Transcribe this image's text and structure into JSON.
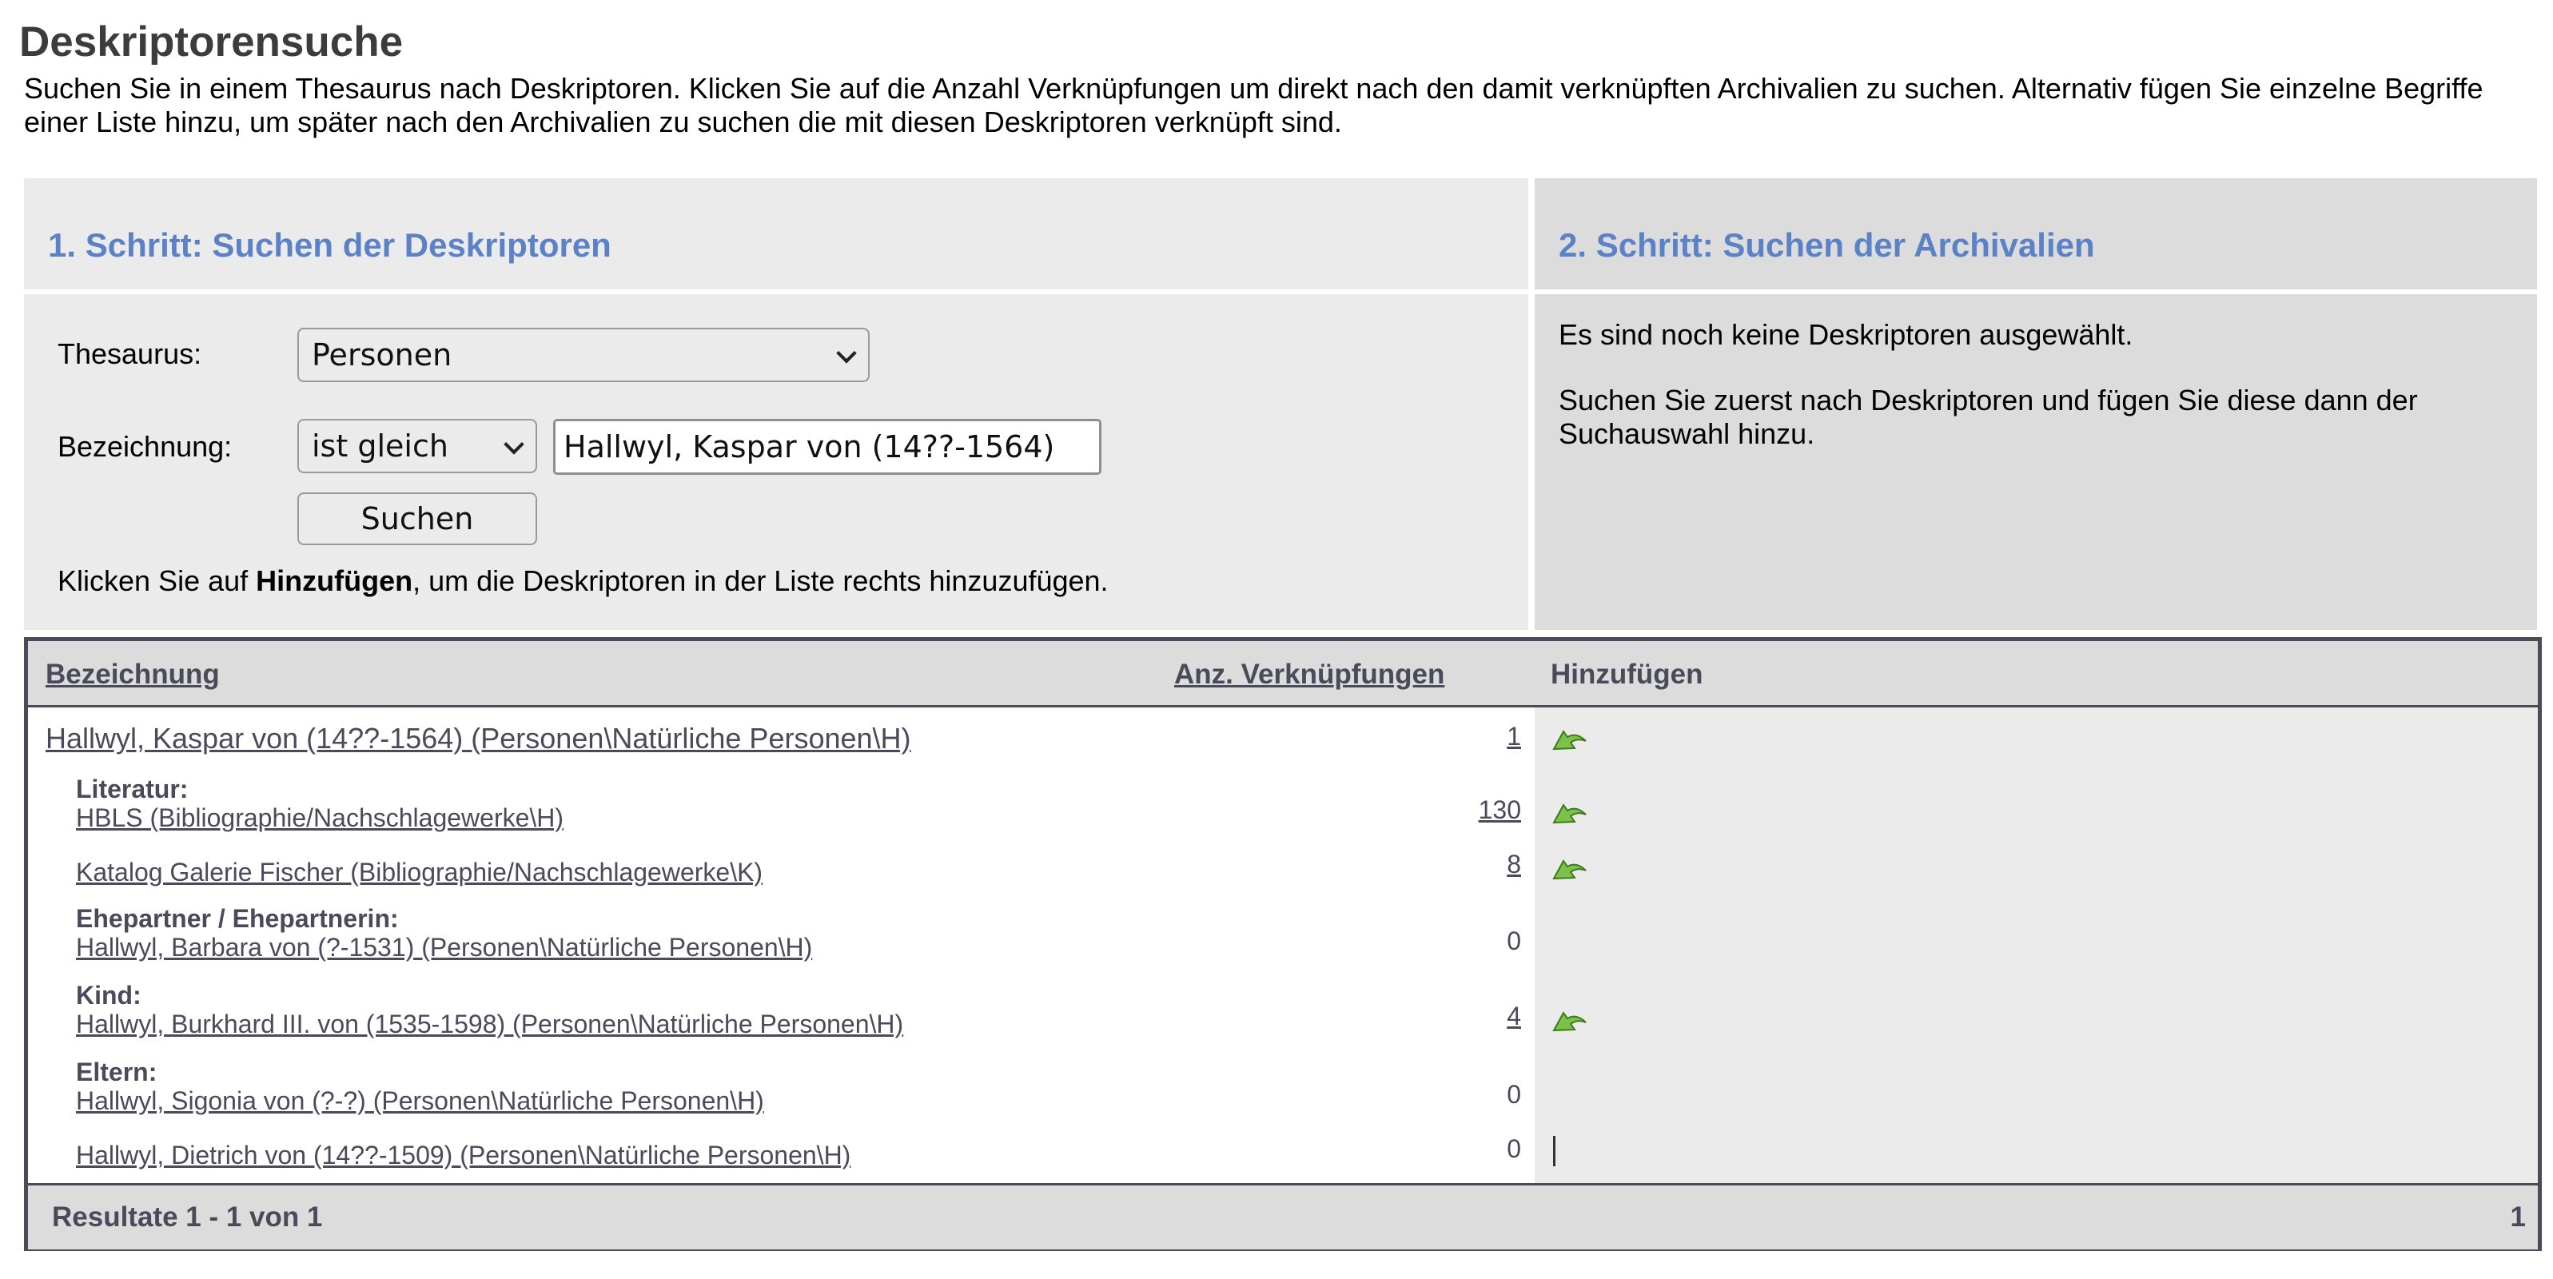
{
  "page": {
    "title": "Deskriptorensuche",
    "intro": "Suchen Sie in einem Thesaurus nach Deskriptoren. Klicken Sie auf die Anzahl Verknüpfungen um direkt nach den damit verknüpften Archivalien zu suchen. Alternativ fügen Sie einzelne Begriffe einer Liste hinzu, um später nach den Archivalien zu suchen die mit diesen Deskriptoren verknüpft sind."
  },
  "step1": {
    "title": "1. Schritt: Suchen der Deskriptoren",
    "thesaurus_label": "Thesaurus:",
    "thesaurus_value": "Personen",
    "bezeichnung_label": "Bezeichnung:",
    "operator_value": "ist gleich",
    "search_value": "Hallwyl, Kaspar von (14??-1564)",
    "search_button": "Suchen",
    "hint_prefix": "Klicken Sie auf ",
    "hint_bold": "Hinzufügen",
    "hint_suffix": ", um die Deskriptoren in der Liste rechts hinzuzufügen."
  },
  "step2": {
    "title": "2. Schritt: Suchen der Archivalien",
    "msg1": "Es sind noch keine Deskriptoren ausgewählt.",
    "msg2": "Suchen Sie zuerst nach Deskriptoren und fügen Sie diese dann der Suchauswahl hinzu."
  },
  "table": {
    "col_name": "Bezeichnung",
    "col_count": "Anz. Verknüpfungen",
    "col_add": "Hinzufügen",
    "main_row": {
      "name": "Hallwyl, Kaspar von (14??-1564) (Personen\\Natürliche Personen\\H)",
      "count": "1"
    },
    "rows": [
      {
        "relation": "Literatur:",
        "name": "HBLS (Bibliographie/Nachschlagewerke\\H)",
        "count": "130"
      },
      {
        "relation": "",
        "name": "Katalog Galerie Fischer (Bibliographie/Nachschlagewerke\\K)",
        "count": "8"
      },
      {
        "relation": "Ehepartner / Ehepartnerin:",
        "name": "Hallwyl, Barbara von (?-1531) (Personen\\Natürliche Personen\\H)",
        "count": "0"
      },
      {
        "relation": "Kind:",
        "name": "Hallwyl, Burkhard III. von (1535-1598) (Personen\\Natürliche Personen\\H)",
        "count": "4"
      },
      {
        "relation": "Eltern:",
        "name": "Hallwyl, Sigonia von (?-?) (Personen\\Natürliche Personen\\H)",
        "count": "0"
      },
      {
        "relation": "",
        "name": "Hallwyl, Dietrich von (14??-1509) (Personen\\Natürliche Personen\\H)",
        "count": "0"
      }
    ],
    "footer_text": "Resultate 1 - 1 von 1",
    "footer_page": "1"
  },
  "icons": {
    "add": "add-arrow-icon",
    "add_color": "#7cc24a"
  }
}
